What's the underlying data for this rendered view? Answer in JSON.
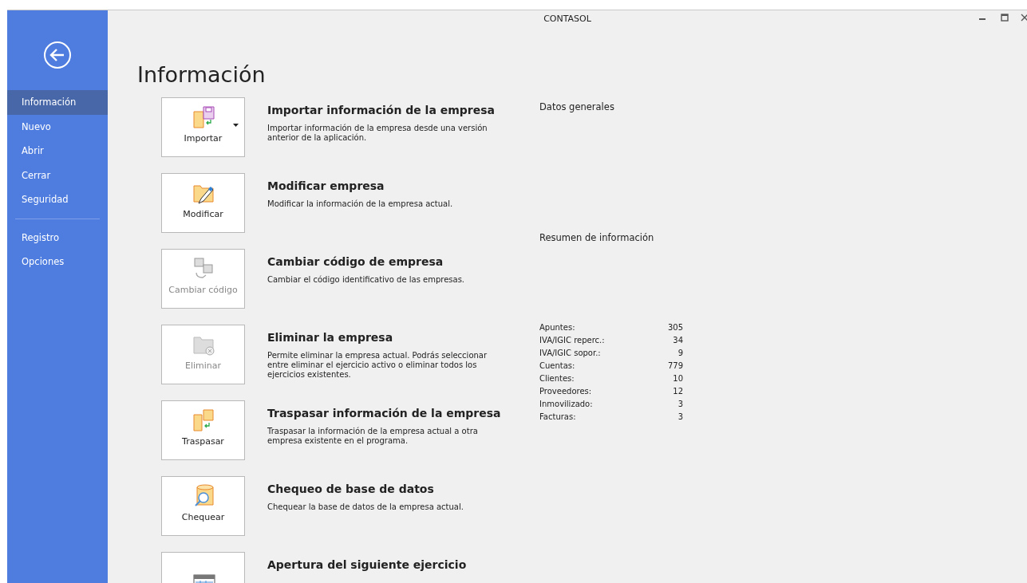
{
  "window": {
    "title": "CONTASOL"
  },
  "sidebar": {
    "sections": [
      [
        {
          "label": "Información",
          "selected": true
        },
        {
          "label": "Nuevo",
          "selected": false
        },
        {
          "label": "Abrir",
          "selected": false
        },
        {
          "label": "Cerrar",
          "selected": false
        },
        {
          "label": "Seguridad",
          "selected": false
        }
      ],
      [
        {
          "label": "Registro",
          "selected": false
        },
        {
          "label": "Opciones",
          "selected": false
        }
      ]
    ]
  },
  "heading": "Información",
  "actions": [
    {
      "kind": "import",
      "label": "Importar",
      "dropdown": true,
      "disabled": false,
      "title": "Importar información de la empresa",
      "description": "Importar información de la empresa desde una versión anterior de la aplicación."
    },
    {
      "kind": "edit",
      "label": "Modificar",
      "dropdown": false,
      "disabled": false,
      "title": "Modificar empresa",
      "description": "Modificar la información de la empresa actual."
    },
    {
      "kind": "code",
      "label": "Cambiar código",
      "dropdown": false,
      "disabled": true,
      "title": "Cambiar código de empresa",
      "description": "Cambiar el código identificativo de las empresas."
    },
    {
      "kind": "delete",
      "label": "Eliminar",
      "dropdown": false,
      "disabled": true,
      "title": "Eliminar la empresa",
      "description": "Permite eliminar la empresa actual. Podrás seleccionar entre eliminar el ejercicio activo o eliminar todos los ejercicios existentes."
    },
    {
      "kind": "transfer",
      "label": "Traspasar",
      "dropdown": false,
      "disabled": false,
      "title": "Traspasar información de la empresa",
      "description": "Traspasar la información de la empresa actual a otra empresa existente en el programa."
    },
    {
      "kind": "check",
      "label": "Chequear",
      "dropdown": false,
      "disabled": false,
      "title": "Chequeo de base de datos",
      "description": "Chequear la base de datos de la empresa actual."
    },
    {
      "kind": "calendar",
      "dropdown": false,
      "disabled": false,
      "title": "Apertura del siguiente ejercicio"
    }
  ],
  "info": {
    "general_title": "Datos generales",
    "summary_title": "Resumen de información",
    "stats": [
      {
        "label": "Apuntes:",
        "value": "305"
      },
      {
        "label": "IVA/IGIC reperc.:",
        "value": "34"
      },
      {
        "label": "IVA/IGIC sopor.:",
        "value": "9"
      },
      {
        "label": "Cuentas:",
        "value": "779"
      },
      {
        "label": "Clientes:",
        "value": "10"
      },
      {
        "label": "Proveedores:",
        "value": "12"
      },
      {
        "label": "Inmovilizado:",
        "value": "3"
      },
      {
        "label": "Facturas:",
        "value": "3"
      }
    ]
  }
}
